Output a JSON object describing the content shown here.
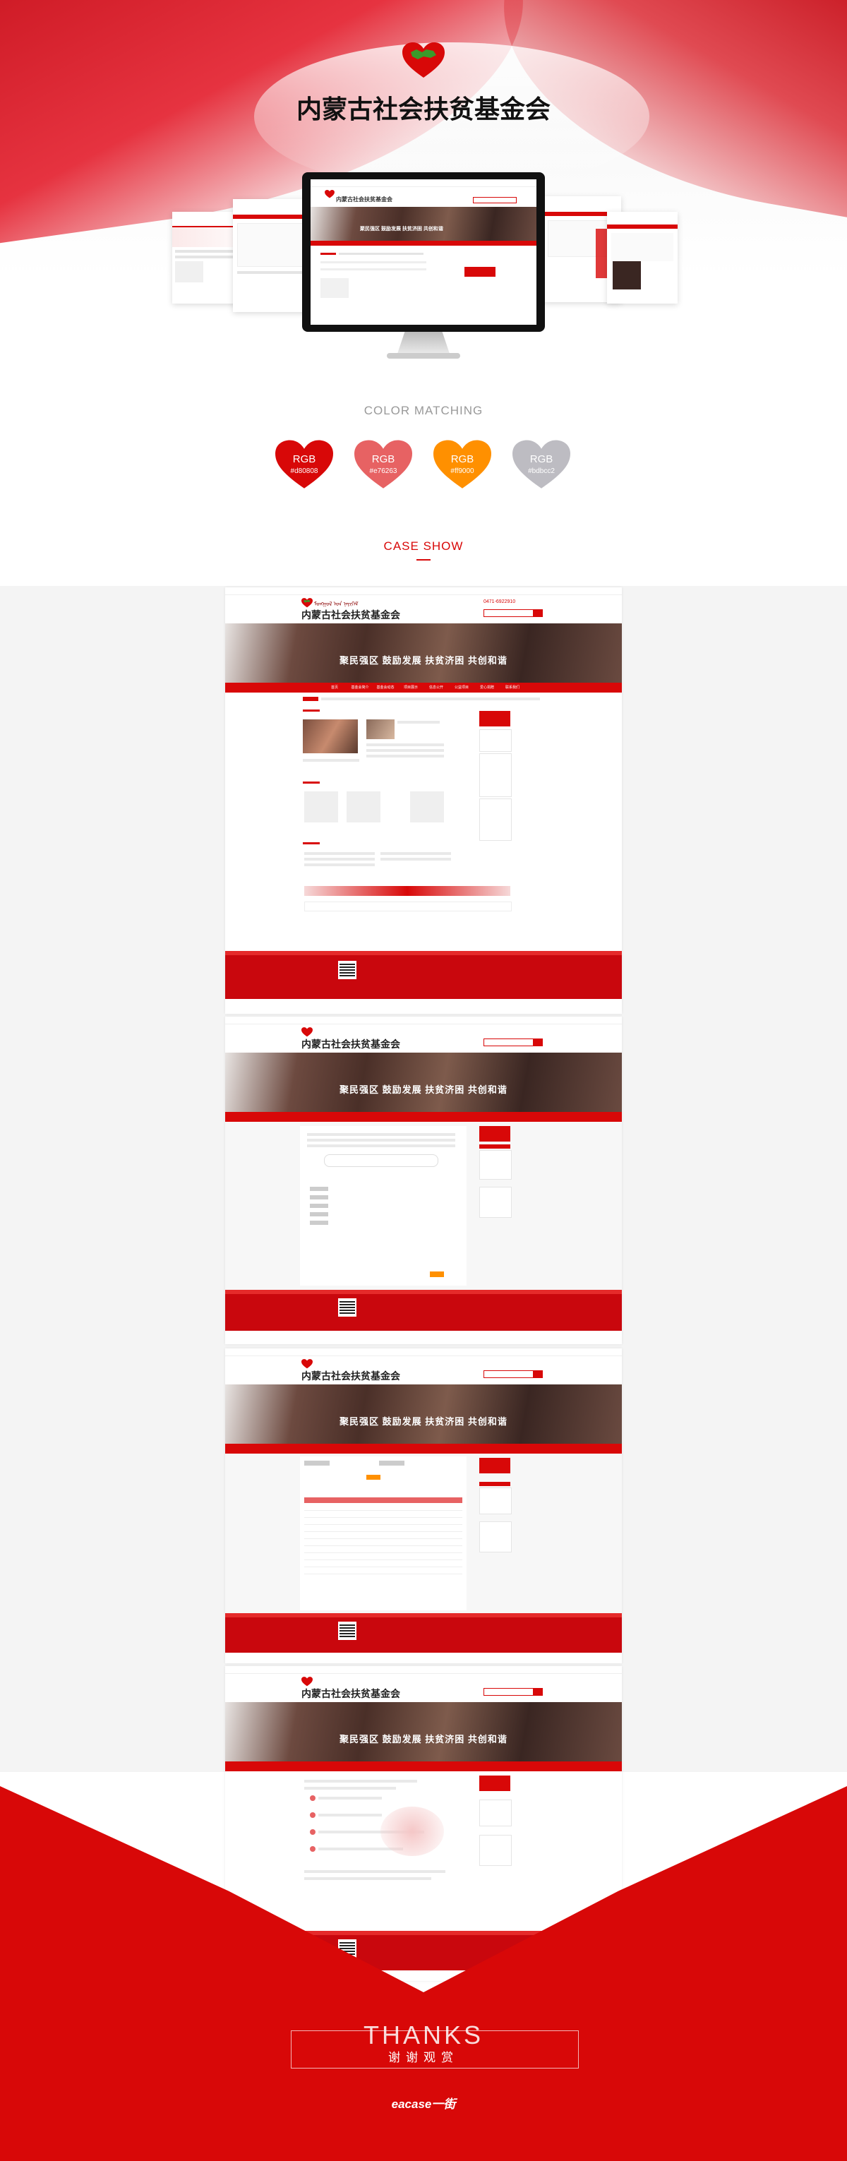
{
  "hero": {
    "title": "内蒙古社会扶贫基金会"
  },
  "mini_site": {
    "brand": "内蒙古社会扶贫基金会",
    "mongolian": "ᠮᠣᠩᠭᠣᠯ ᠤᠨ ᠨᠡᠶᠢᠭᠡᠮ",
    "phone": "0471-6922910",
    "slogan": "聚民强区  鼓励发展  扶贫济困  共创和谐",
    "nav": [
      "首页",
      "基金会简介",
      "基金会动态",
      "项目展示",
      "信息公开",
      "公益项目",
      "爱心捐赠",
      "联系我们"
    ]
  },
  "color_matching": {
    "title": "COLOR MATCHING",
    "colors": [
      {
        "label": "RGB",
        "hex": "#d80808",
        "code": "#d80808"
      },
      {
        "label": "RGB",
        "hex": "#e76263",
        "code": "#e76263"
      },
      {
        "label": "RGB",
        "hex": "#ff9000",
        "code": "#ff9000"
      },
      {
        "label": "RGB",
        "hex": "#bdbcc2",
        "code": "#bdbcc2"
      }
    ]
  },
  "case_show": {
    "title": "CASE SHOW"
  },
  "footer": {
    "thanks": "THANKS",
    "thanks_cn": "谢谢观赏",
    "credit": "eacase一街"
  },
  "colors": {
    "brand_red": "#d80808",
    "dark_red": "#c9070d"
  }
}
